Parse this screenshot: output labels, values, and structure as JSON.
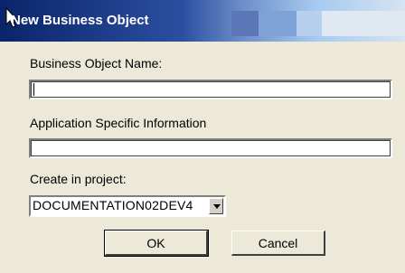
{
  "dialog": {
    "title": "New Business Object",
    "name_label": "Business Object Name:",
    "name_value": "",
    "asi_label": "Application Specific Information",
    "asi_value": "",
    "project_label": "Create in project:",
    "project_value": "DOCUMENTATION02DEV4",
    "ok_label": "OK",
    "cancel_label": "Cancel"
  }
}
